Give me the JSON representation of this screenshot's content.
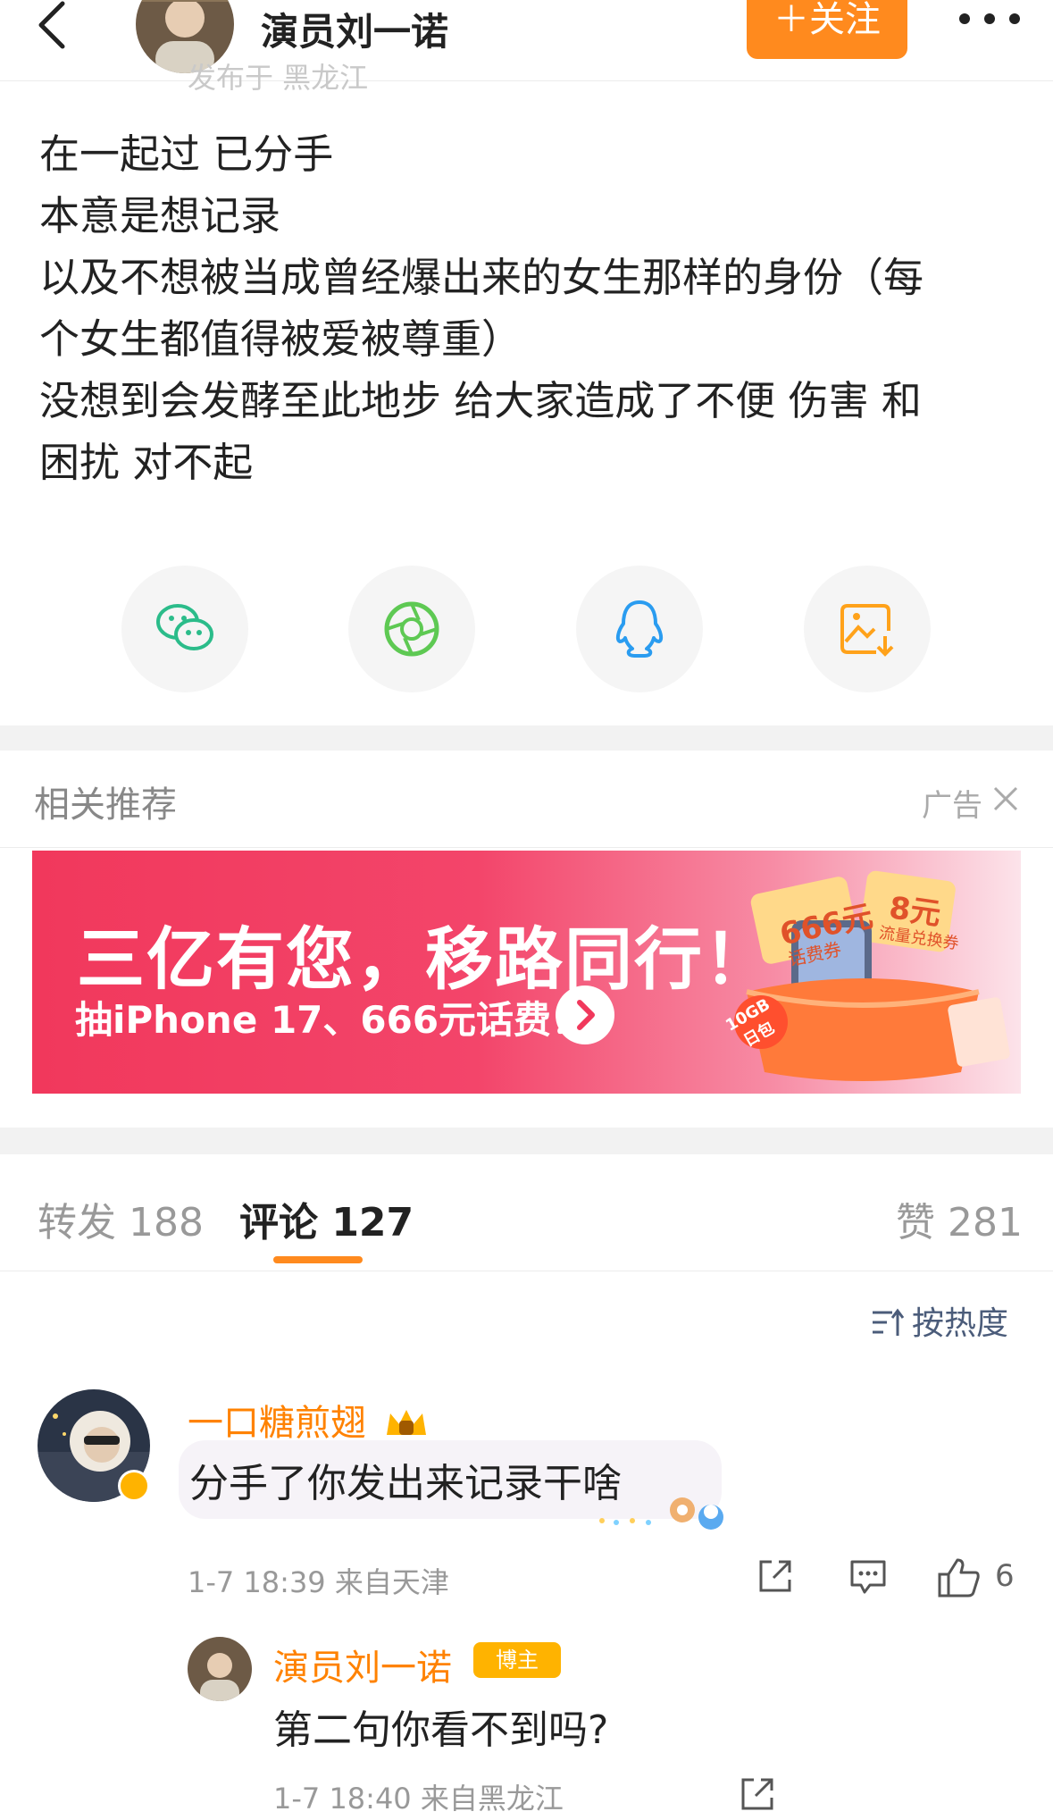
{
  "header": {
    "name": "演员刘一诺",
    "follow_label": "＋关注",
    "sub_line": "发布于 黑龙江"
  },
  "post": {
    "lines": [
      "在一起过 已分手",
      "本意是想记录",
      "以及不想被当成曾经爆出来的女生那样的身份（每",
      "个女生都值得被爱被尊重）",
      "没想到会发酵至此地步 给大家造成了不便 伤害 和",
      "困扰 对不起"
    ]
  },
  "share": {
    "icons": [
      "wechat-icon",
      "moments-icon",
      "qq-icon",
      "save-image-icon"
    ],
    "colors": {
      "wechat": "#2bbc8a",
      "moments": "#5ec953",
      "qq": "#2a9cf0",
      "save": "#ffa21a"
    }
  },
  "recommend": {
    "title": "相关推荐",
    "ad_label": "广告"
  },
  "banner": {
    "title": "三亿有您，移路同行！",
    "subtitle": "抽iPhone 17、666元话费！",
    "coupon_1": "666元",
    "coupon_1_sub": "话费券",
    "coupon_2": "8元",
    "coupon_2_sub": "流量兑换券",
    "tag": "10GB 日包"
  },
  "tabs": {
    "repost": "转发 188",
    "comment": "评论 127",
    "like": "赞 281"
  },
  "sort_label": "按热度",
  "comment": {
    "name": "一口糖煎翅",
    "text": "分手了你发出来记录干啥",
    "meta": "1-7 18:39  来自天津",
    "likes": "6"
  },
  "reply": {
    "name": "演员刘一诺",
    "badge": "博主",
    "text": "第二句你看不到吗?",
    "meta": "1-7 18:40  来自黑龙江"
  },
  "colors": {
    "accent": "#ff8a1e",
    "username": "#ff8200",
    "banner": "#f1385c"
  }
}
